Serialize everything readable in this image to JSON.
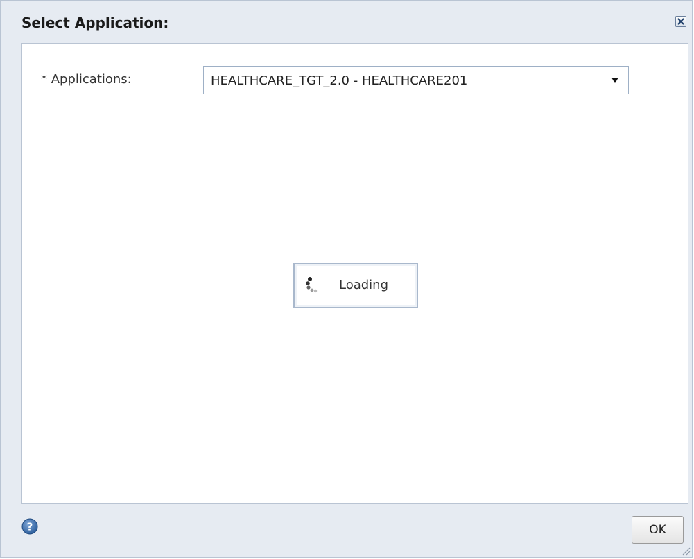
{
  "dialog": {
    "title": "Select Application:",
    "close_icon": "close-icon"
  },
  "form": {
    "applications_label": "* Applications:",
    "applications_selected": "HEALTHCARE_TGT_2.0 - HEALTHCARE201",
    "dropdown_icon": "dropdown-arrow-icon"
  },
  "loading": {
    "text": "Loading",
    "icon": "spinner-icon"
  },
  "footer": {
    "help_icon": "help-icon",
    "ok_label": "OK"
  },
  "colors": {
    "header_bg": "#e6ebf2",
    "border": "#b9c4d3",
    "help_blue": "#2d5f9e"
  }
}
